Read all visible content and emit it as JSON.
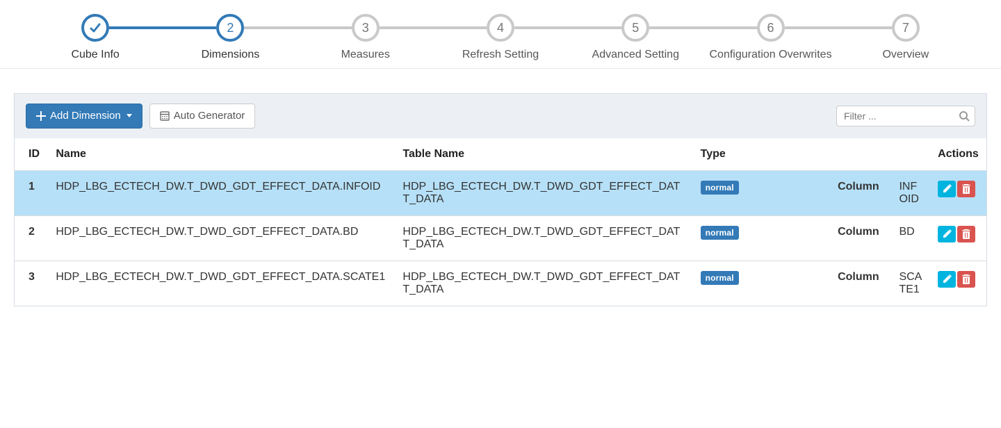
{
  "stepper": {
    "steps": [
      {
        "label": "Cube Info",
        "state": "done",
        "num": ""
      },
      {
        "label": "Dimensions",
        "state": "current",
        "num": "2"
      },
      {
        "label": "Measures",
        "state": "todo",
        "num": "3"
      },
      {
        "label": "Refresh Setting",
        "state": "todo",
        "num": "4"
      },
      {
        "label": "Advanced Setting",
        "state": "todo",
        "num": "5"
      },
      {
        "label": "Configuration Overwrites",
        "state": "todo",
        "num": "6"
      },
      {
        "label": "Overview",
        "state": "todo",
        "num": "7"
      }
    ]
  },
  "toolbar": {
    "add_dimension_label": "Add Dimension",
    "auto_generator_label": "Auto Generator",
    "filter_placeholder": "Filter ..."
  },
  "table": {
    "headers": {
      "id": "ID",
      "name": "Name",
      "table_name": "Table Name",
      "type": "Type",
      "actions": "Actions"
    },
    "column_label": "Column",
    "type_badge": "normal",
    "rows": [
      {
        "id": "1",
        "name": "HDP_LBG_ECTECH_DW.T_DWD_GDT_EFFECT_DATA.INFOID",
        "table_name": "HDP_LBG_ECTECH_DW.T_DWD_GDT_EFFECT_DAT T_DATA",
        "column_value": "INFOID",
        "active": true
      },
      {
        "id": "2",
        "name": "HDP_LBG_ECTECH_DW.T_DWD_GDT_EFFECT_DATA.BD",
        "table_name": "HDP_LBG_ECTECH_DW.T_DWD_GDT_EFFECT_DAT T_DATA",
        "column_value": "BD",
        "active": false
      },
      {
        "id": "3",
        "name": "HDP_LBG_ECTECH_DW.T_DWD_GDT_EFFECT_DATA.SCATE1",
        "table_name": "HDP_LBG_ECTECH_DW.T_DWD_GDT_EFFECT_DAT T_DATA",
        "column_value": "SCATE1",
        "active": false
      }
    ]
  }
}
